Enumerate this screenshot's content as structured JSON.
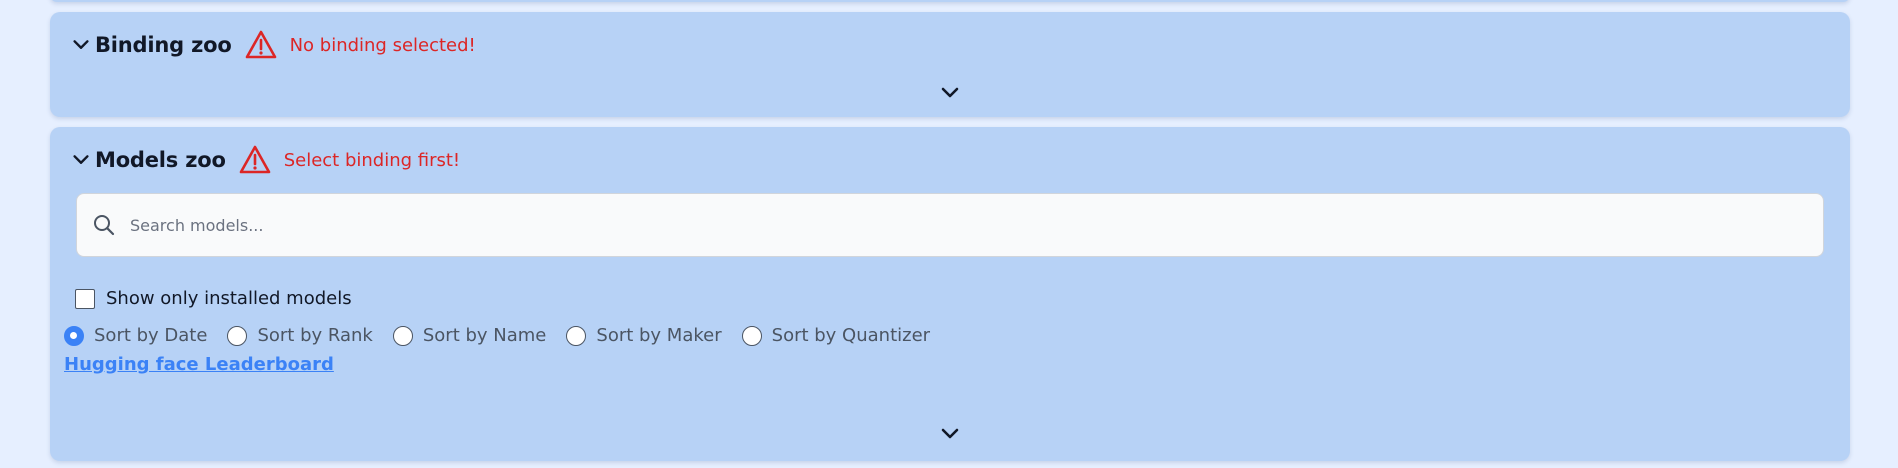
{
  "binding_zoo": {
    "title": "Binding zoo",
    "warning": "No binding selected!"
  },
  "models_zoo": {
    "title": "Models zoo",
    "warning": "Select binding first!",
    "search": {
      "placeholder": "Search models...",
      "value": ""
    },
    "installed_filter": {
      "label": "Show only installed models",
      "checked": false
    },
    "sort_options": [
      {
        "label": "Sort by Date",
        "selected": true
      },
      {
        "label": "Sort by Rank",
        "selected": false
      },
      {
        "label": "Sort by Name",
        "selected": false
      },
      {
        "label": "Sort by Maker",
        "selected": false
      },
      {
        "label": "Sort by Quantizer",
        "selected": false
      }
    ],
    "leaderboard_link": "Hugging face Leaderboard"
  },
  "colors": {
    "panel": "#b7d2f6",
    "background": "#e6efff",
    "warning": "#dc2626",
    "accent": "#3b82f6"
  },
  "icons": {
    "collapse": "chevron-down-icon",
    "warning": "warning-triangle-icon",
    "search": "search-icon",
    "expand": "chevron-down-icon"
  }
}
